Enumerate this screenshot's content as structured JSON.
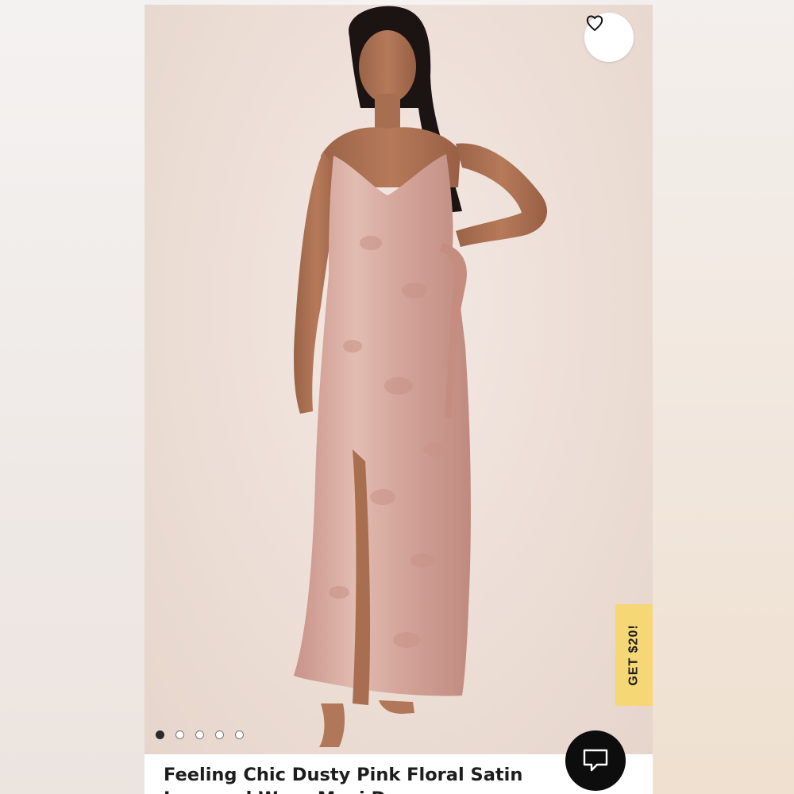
{
  "product": {
    "title": "Feeling Chic Dusty Pink Floral Satin Jacquard Wrap Maxi Dress"
  },
  "wishlist_icon": "heart-outline-icon",
  "promo": {
    "label": "GET $20!",
    "color": "#f6d776"
  },
  "carousel": {
    "total": 5,
    "active": 1
  },
  "chat": {
    "icon": "chat-bubble-icon",
    "color": "#0d0d0d"
  },
  "colors": {
    "dress": "#d7aba2",
    "background": "#ecded6"
  }
}
